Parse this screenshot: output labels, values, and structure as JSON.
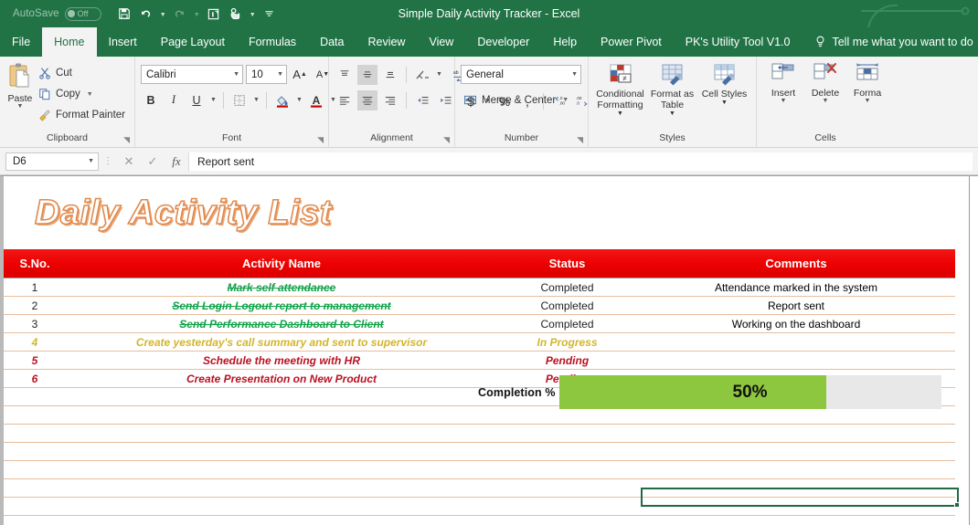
{
  "titlebar": {
    "autosave_label": "AutoSave",
    "autosave_state": "Off",
    "document_title": "Simple Daily Activity Tracker  -  Excel",
    "qat": [
      {
        "name": "save-icon",
        "label": "Save"
      },
      {
        "name": "undo-icon",
        "label": "Undo"
      },
      {
        "name": "redo-icon",
        "label": "Redo"
      },
      {
        "name": "touch-pen-icon",
        "label": "Draw"
      },
      {
        "name": "touch-mode-icon",
        "label": "Touch/Mouse Mode"
      },
      {
        "name": "customize-qat-icon",
        "label": "Customize Quick Access Toolbar"
      }
    ]
  },
  "tabs": [
    {
      "label": "File",
      "active": false
    },
    {
      "label": "Home",
      "active": true
    },
    {
      "label": "Insert",
      "active": false
    },
    {
      "label": "Page Layout",
      "active": false
    },
    {
      "label": "Formulas",
      "active": false
    },
    {
      "label": "Data",
      "active": false
    },
    {
      "label": "Review",
      "active": false
    },
    {
      "label": "View",
      "active": false
    },
    {
      "label": "Developer",
      "active": false
    },
    {
      "label": "Help",
      "active": false
    },
    {
      "label": "Power Pivot",
      "active": false
    },
    {
      "label": "PK's Utility Tool V1.0",
      "active": false
    }
  ],
  "tellme": {
    "label": "Tell me what you want to do"
  },
  "ribbon": {
    "clipboard": {
      "name": "Clipboard",
      "paste": "Paste",
      "cut": "Cut",
      "copy": "Copy",
      "format_painter": "Format Painter"
    },
    "font": {
      "name": "Font",
      "font_family": "Calibri",
      "font_size": "10",
      "grow_font": "A",
      "shrink_font": "A",
      "bold": "B",
      "italic": "I",
      "underline": "U"
    },
    "alignment": {
      "name": "Alignment",
      "wrap_text": "Wrap Text",
      "merge_center": "Merge & Center"
    },
    "number": {
      "name": "Number",
      "format": "General",
      "currency": "$",
      "percent": "%",
      "comma": ","
    },
    "styles": {
      "name": "Styles",
      "conditional_formatting": "Conditional Formatting",
      "format_as_table": "Format as Table",
      "cell_styles": "Cell Styles"
    },
    "cells": {
      "name": "Cells",
      "insert": "Insert",
      "delete": "Delete",
      "format": "Forma"
    }
  },
  "formula_bar": {
    "name_box": "D6",
    "cancel_icon": "✕",
    "enter_icon": "✓",
    "function_icon": "fx",
    "content": "Report sent"
  },
  "sheet": {
    "title": "Daily Activity List",
    "completion": {
      "label": "Completion %",
      "value_text": "50%",
      "percent": 50,
      "bar_fill_ratio": 70,
      "fill_color": "#8dc63f",
      "track_color": "#e8e8e8"
    },
    "table": {
      "headers": [
        "S.No.",
        "Activity Name",
        "Status",
        "Comments"
      ],
      "header_bg": "#ec0000",
      "rows": [
        {
          "sno": "1",
          "activity": "Mark self attendance",
          "status": "Completed",
          "comment": "Attendance marked in the system",
          "state": "done"
        },
        {
          "sno": "2",
          "activity": "Send Login Logout report to management",
          "status": "Completed",
          "comment": "Report sent",
          "state": "done"
        },
        {
          "sno": "3",
          "activity": "Send Performance Dashboard to Client",
          "status": "Completed",
          "comment": "Working on the dashboard",
          "state": "done"
        },
        {
          "sno": "4",
          "activity": "Create yesterday's call summary and sent to supervisor",
          "status": "In Progress",
          "comment": "",
          "state": "prog"
        },
        {
          "sno": "5",
          "activity": "Schedule the meeting with HR",
          "status": "Pending",
          "comment": "",
          "state": "pend"
        },
        {
          "sno": "6",
          "activity": "Create Presentation on New Product",
          "status": "Pending",
          "comment": "",
          "state": "pend"
        },
        {
          "sno": "",
          "activity": "",
          "status": "",
          "comment": "",
          "state": "empty"
        },
        {
          "sno": "",
          "activity": "",
          "status": "",
          "comment": "",
          "state": "empty"
        },
        {
          "sno": "",
          "activity": "",
          "status": "",
          "comment": "",
          "state": "empty"
        },
        {
          "sno": "",
          "activity": "",
          "status": "",
          "comment": "",
          "state": "empty"
        },
        {
          "sno": "",
          "activity": "",
          "status": "",
          "comment": "",
          "state": "empty"
        },
        {
          "sno": "",
          "activity": "",
          "status": "",
          "comment": "",
          "state": "empty"
        },
        {
          "sno": "",
          "activity": "",
          "status": "",
          "comment": "",
          "state": "empty"
        }
      ]
    },
    "selected_cell": "D6"
  }
}
